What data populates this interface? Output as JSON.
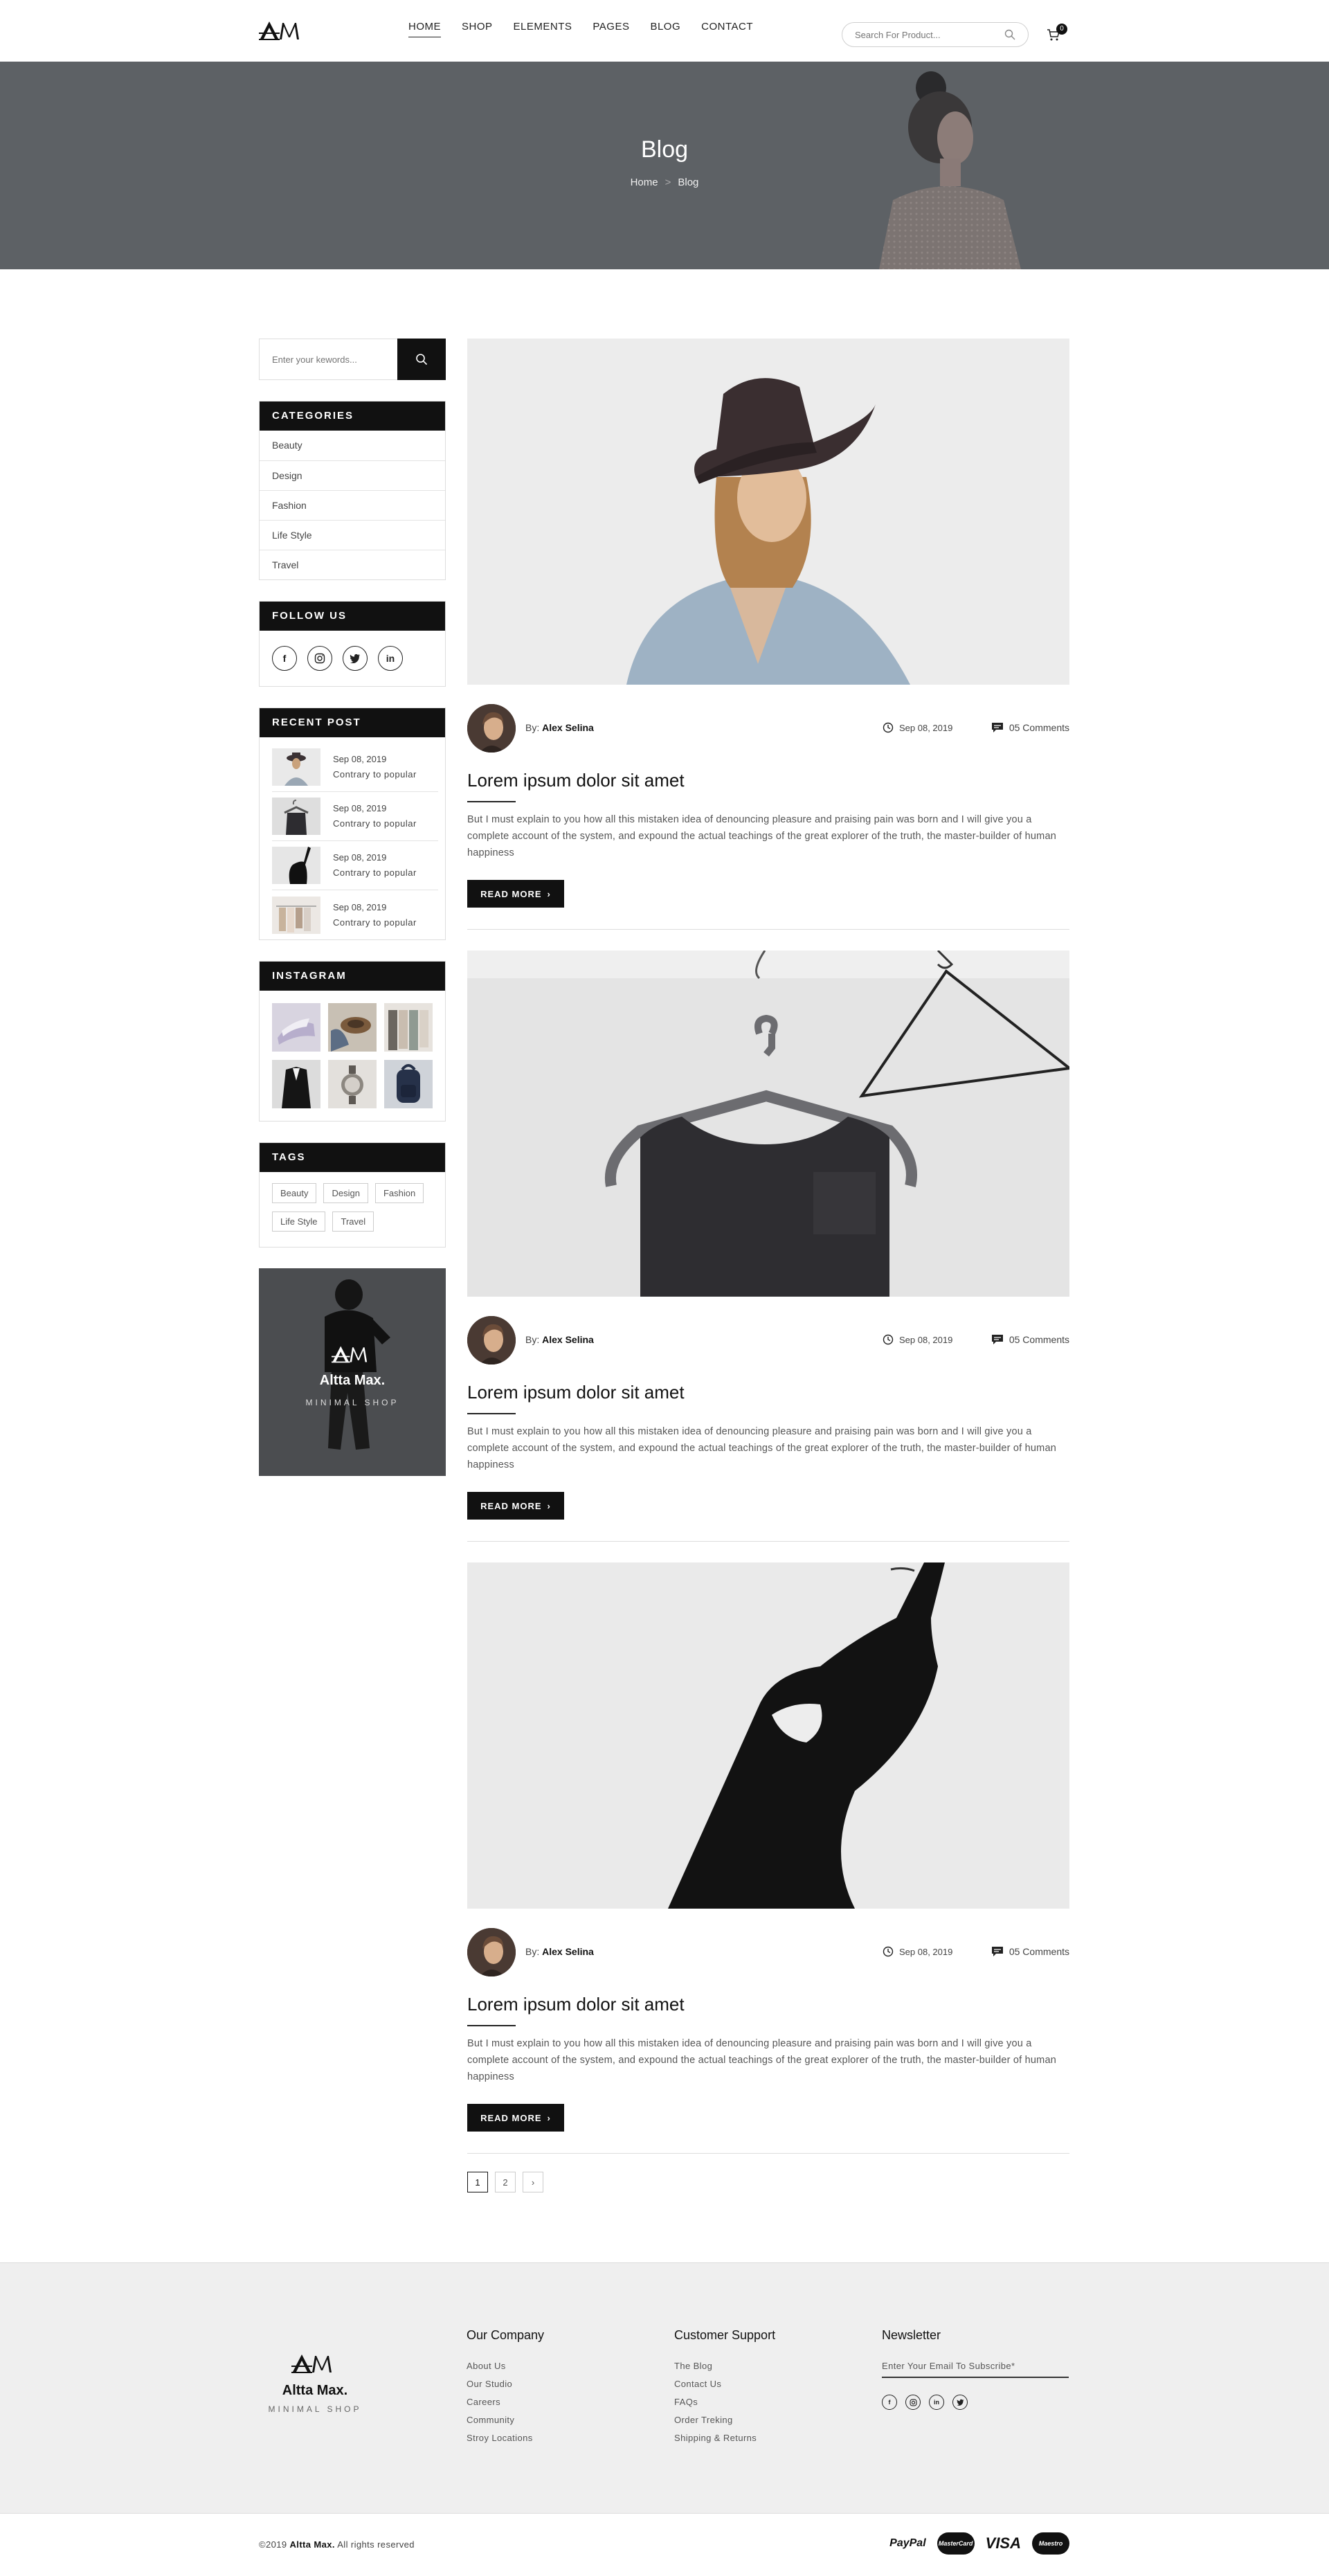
{
  "header": {
    "logo_text": "AM",
    "nav": [
      {
        "label": "HOME",
        "active": true
      },
      {
        "label": "SHOP",
        "active": false
      },
      {
        "label": "ELEMENTS",
        "active": false
      },
      {
        "label": "PAGES",
        "active": false
      },
      {
        "label": "BLOG",
        "active": false
      },
      {
        "label": "CONTACT",
        "active": false
      }
    ],
    "search_placeholder": "Search For Product...",
    "cart_count": "0"
  },
  "banner": {
    "title": "Blog",
    "breadcrumb": [
      "Home",
      "Blog"
    ],
    "breadcrumb_sep": ">"
  },
  "sidebar": {
    "search_placeholder": "Enter your kewords...",
    "categories": {
      "title": "CATEGORIES",
      "items": [
        "Beauty",
        "Design",
        "Fashion",
        "Life Style",
        "Travel"
      ]
    },
    "follow": {
      "title": "FOLLOW US",
      "icons": [
        "facebook-icon",
        "instagram-icon",
        "twitter-icon",
        "linkedin-icon"
      ]
    },
    "recent": {
      "title": "RECENT POST",
      "items": [
        {
          "date": "Sep 08, 2019",
          "title": "Contrary to popular"
        },
        {
          "date": "Sep 08, 2019",
          "title": "Contrary to popular"
        },
        {
          "date": "Sep 08, 2019",
          "title": "Contrary to popular"
        },
        {
          "date": "Sep 08, 2019",
          "title": "Contrary to popular"
        }
      ]
    },
    "instagram": {
      "title": "INSTAGRAM"
    },
    "tags": {
      "title": "TAGS",
      "items": [
        "Beauty",
        "Design",
        "Fashion",
        "Life Style",
        "Travel"
      ]
    },
    "promo": {
      "name": "Altta Max.",
      "sub": "MINIMAL SHOP"
    }
  },
  "posts": [
    {
      "author_prefix": "By:",
      "author": "Alex Selina",
      "date": "Sep 08, 2019",
      "comments": "05 Comments",
      "title": "Lorem ipsum dolor sit amet",
      "excerpt": "But I must explain to you how all this mistaken idea of denouncing pleasure and praising pain was born and I will give you a complete account of the system, and expound the actual teachings of the great explorer of the truth, the master-builder of human happiness",
      "button": "READ MORE"
    },
    {
      "author_prefix": "By:",
      "author": "Alex Selina",
      "date": "Sep 08, 2019",
      "comments": "05 Comments",
      "title": "Lorem ipsum dolor sit amet",
      "excerpt": "But I must explain to you how all this mistaken idea of denouncing pleasure and praising pain was born and I will give you a complete account of the system, and expound the actual teachings of the great explorer of the truth, the master-builder of human happiness",
      "button": "READ MORE"
    },
    {
      "author_prefix": "By:",
      "author": "Alex Selina",
      "date": "Sep 08, 2019",
      "comments": "05 Comments",
      "title": "Lorem ipsum dolor sit amet",
      "excerpt": "But I must explain to you how all this mistaken idea of denouncing pleasure and praising pain was born and I will give you a complete account of the system, and expound the actual teachings of the great explorer of the truth, the master-builder of human happiness",
      "button": "READ MORE"
    }
  ],
  "pagination": [
    "1",
    "2",
    "›"
  ],
  "footer": {
    "brand_name": "Altta Max.",
    "brand_sub": "MINIMAL SHOP",
    "company": {
      "title": "Our Company",
      "links": [
        "About Us",
        "Our Studio",
        "Careers",
        "Community",
        "Stroy Locations"
      ]
    },
    "support": {
      "title": "Customer Support",
      "links": [
        "The Blog",
        "Contact Us",
        "FAQs",
        "Order Treking",
        "Shipping & Returns"
      ]
    },
    "newsletter": {
      "title": "Newsletter",
      "placeholder": "Enter Your Email To Subscribe*"
    },
    "copyright_year": "©2019",
    "copyright_brand": "Altta Max.",
    "copyright_rest": "All rights reserved",
    "payments": [
      "PayPal",
      "MasterCard",
      "VISA",
      "Maestro"
    ]
  },
  "colors": {
    "banner_bg": "#5d6165",
    "accent": "#111111",
    "footer_bg": "#efefef"
  }
}
